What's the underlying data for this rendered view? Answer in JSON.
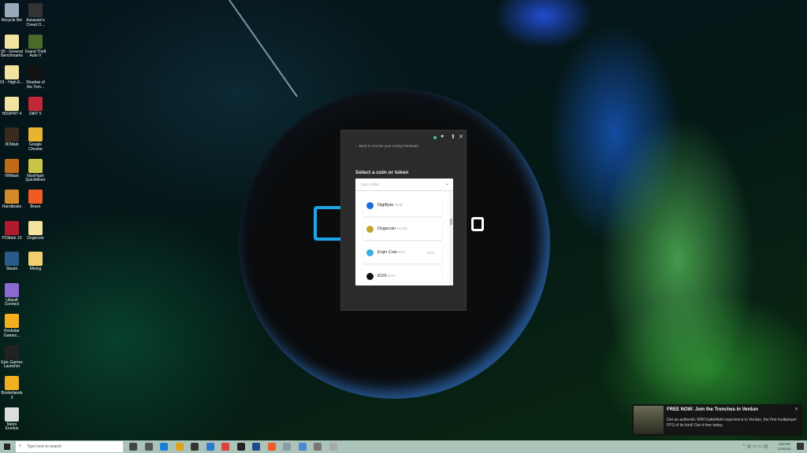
{
  "desktop_icons": [
    {
      "label": "Recycle Bin",
      "color": "#9ab"
    },
    {
      "label": "Assassin's Creed O...",
      "color": "#333"
    },
    {
      "label": "00 - General Benchmarks",
      "color": "#f2e3a0"
    },
    {
      "label": "Grand Theft Auto V",
      "color": "#4a6b2a"
    },
    {
      "label": "01 - High-E...",
      "color": "#f2e3a0"
    },
    {
      "label": "Shadow of the Tom...",
      "color": "#111"
    },
    {
      "label": "HDXPRT 4",
      "color": "#f2e3a0"
    },
    {
      "label": "DiRT 5",
      "color": "#c2283a"
    },
    {
      "label": "3DMark",
      "color": "#3a2a20"
    },
    {
      "label": "Google Chrome",
      "color": "#e9b330"
    },
    {
      "label": "VRMark",
      "color": "#c06a18"
    },
    {
      "label": "NiceHash QuickMiner",
      "color": "#c9c44a"
    },
    {
      "label": "Handbrake",
      "color": "#d48a2a"
    },
    {
      "label": "Brave",
      "color": "#f05a24"
    },
    {
      "label": "PCMark 10",
      "color": "#b01a2a"
    },
    {
      "label": "Dogecoin",
      "color": "#f2e3a0"
    },
    {
      "label": "Steam",
      "color": "#2a5a8a"
    },
    {
      "label": "Mining",
      "color": "#f2d070"
    },
    {
      "label": "Ubisoft Connect",
      "color": "#8a6ad0"
    },
    {
      "label": "Rockstar Games...",
      "color": "#f5b020"
    },
    {
      "label": "Epic Games Launcher",
      "color": "#222"
    },
    {
      "label": "Borderlands 3",
      "color": "#f0b020"
    },
    {
      "label": "Metro Exodus",
      "color": "#ddd"
    }
  ],
  "dialog": {
    "back_label": "Back to choose your mining hardware",
    "title": "Select a coin or token",
    "filter_placeholder": "Type to filter",
    "coins": [
      {
        "name": "DigiByte",
        "symbol": "DGB",
        "extra": "",
        "color": "#1a6ed8"
      },
      {
        "name": "Dogecoin",
        "symbol": "DOGE",
        "extra": "",
        "color": "#c2a633"
      },
      {
        "name": "Enjin Coin",
        "symbol": "ENJ",
        "extra": "ETH",
        "color": "#3ab0e0"
      },
      {
        "name": "EOS",
        "symbol": "EOS",
        "extra": "",
        "color": "#111"
      }
    ]
  },
  "toast": {
    "title": "FREE NOW: Join the Trenches in Verdun",
    "body": "Get an authentic WWI battlefield experience in Verdun, the first multiplayer FPS of its kind! Get it free today."
  },
  "taskbar": {
    "search_placeholder": "Type here to search",
    "time": "3:59 PM",
    "date": "7/23/2021",
    "apps": [
      "#444",
      "#555",
      "#1b7fd8",
      "#e0a020",
      "#333",
      "#2a7ad0",
      "#e04040",
      "#222",
      "#1a4a8a",
      "#f05a24",
      "#8a9aa8",
      "#4a8ad0",
      "#777",
      "#aaa"
    ]
  }
}
